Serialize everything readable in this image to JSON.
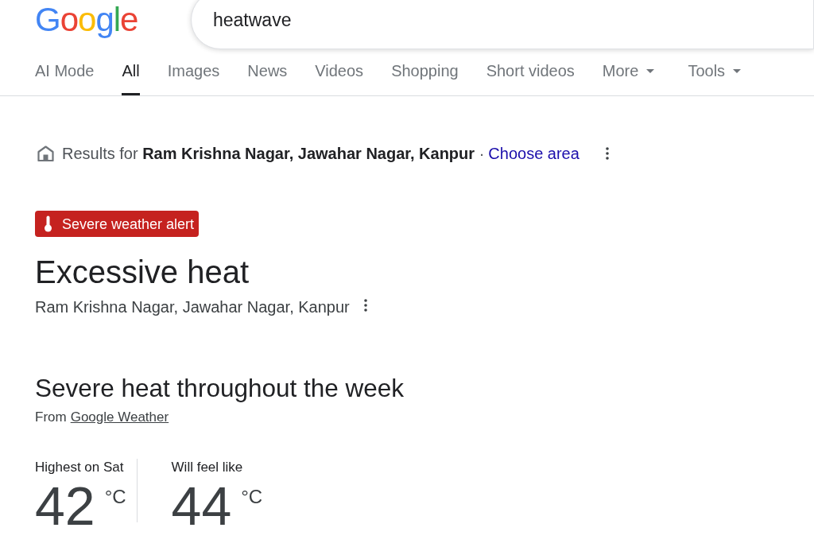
{
  "logo": {
    "text": "Google"
  },
  "search": {
    "value": "heatwave"
  },
  "tabs": [
    {
      "label": "AI Mode",
      "selected": false,
      "menu": false
    },
    {
      "label": "All",
      "selected": true,
      "menu": false
    },
    {
      "label": "Images",
      "selected": false,
      "menu": false
    },
    {
      "label": "News",
      "selected": false,
      "menu": false
    },
    {
      "label": "Videos",
      "selected": false,
      "menu": false
    },
    {
      "label": "Shopping",
      "selected": false,
      "menu": false
    },
    {
      "label": "Short videos",
      "selected": false,
      "menu": false
    },
    {
      "label": "More",
      "selected": false,
      "menu": true
    }
  ],
  "tools": {
    "label": "Tools"
  },
  "location_bar": {
    "text": "Results for **Ram Krishna Nagar, Jawahar Nagar, Kanpur** ·",
    "link": "Choose area"
  },
  "alert": {
    "badge": "Severe weather alert",
    "title": "Excessive heat",
    "location": "Ram Krishna Nagar, Jawahar Nagar, Kanpur"
  },
  "summary": {
    "heading": "Severe heat throughout the week",
    "source_prefix": "From",
    "source_link": "Google Weather"
  },
  "stats": [
    {
      "label": "Highest on Sat",
      "value": "42",
      "unit": "°C"
    },
    {
      "label": "Will feel like",
      "value": "44",
      "unit": "°C"
    }
  ]
}
